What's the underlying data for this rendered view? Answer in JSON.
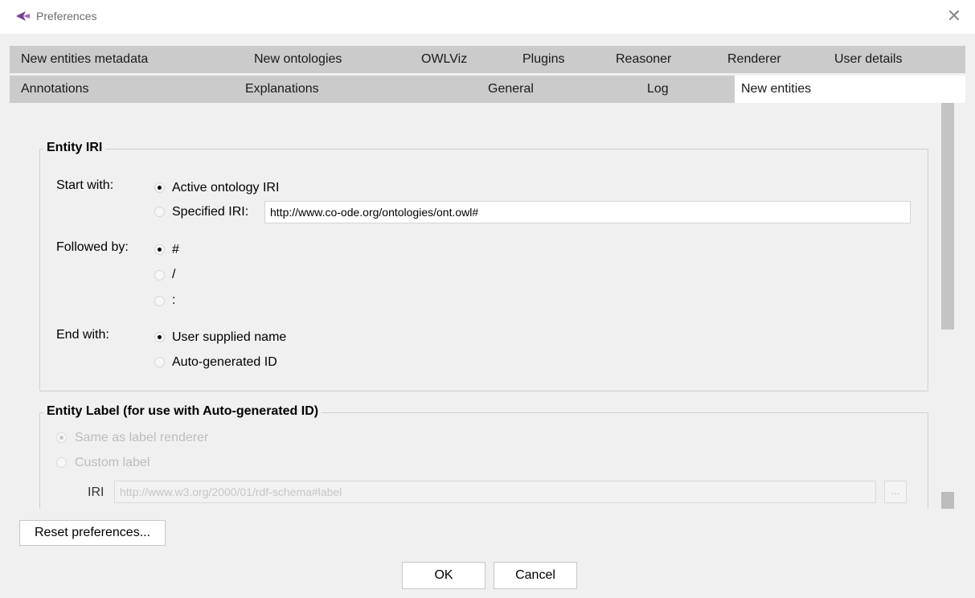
{
  "window": {
    "title": "Preferences",
    "close_glyph": "✕",
    "icon": "protege-logo-icon"
  },
  "tabs": {
    "row1": [
      "New entities metadata",
      "New ontologies",
      "OWLViz",
      "Plugins",
      "Reasoner",
      "Renderer",
      "User details"
    ],
    "row2": [
      "Annotations",
      "Explanations",
      "General",
      "Log",
      "New entities"
    ],
    "active": "New entities"
  },
  "entity_iri": {
    "title": "Entity IRI",
    "start_with": {
      "label": "Start with:",
      "options": [
        "Active ontology IRI",
        "Specified IRI:"
      ],
      "selected": "Active ontology IRI",
      "specified_iri_value": "http://www.co-ode.org/ontologies/ont.owl#"
    },
    "followed_by": {
      "label": "Followed by:",
      "options": [
        "#",
        "/",
        ":"
      ],
      "selected": "#"
    },
    "end_with": {
      "label": "End with:",
      "options": [
        "User supplied name",
        "Auto-generated ID"
      ],
      "selected": "User supplied name"
    }
  },
  "entity_label": {
    "title": "Entity Label (for use with Auto-generated ID)",
    "options": [
      "Same as label renderer",
      "Custom label"
    ],
    "selected": "Same as label renderer",
    "iri_label": "IRI",
    "iri_value": "http://www.w3.org/2000/01/rdf-schema#label",
    "browse_label": "..."
  },
  "footer": {
    "reset_label": "Reset preferences...",
    "ok_label": "OK",
    "cancel_label": "Cancel"
  },
  "colors": {
    "tab_bg": "#cbcbcb",
    "active_tab_bg": "#ffffff",
    "window_bg": "#f0f0f0",
    "disabled_text": "#bdbdbd"
  }
}
